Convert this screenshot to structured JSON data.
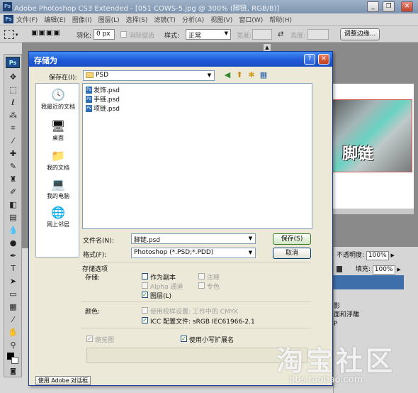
{
  "app": {
    "title": "Adobe Photoshop CS3 Extended - [051 COWS-5.jpg @ 300% (脚链, RGB/8)]",
    "menu": [
      "文件(F)",
      "编辑(E)",
      "图像(I)",
      "图层(L)",
      "选择(S)",
      "滤镜(T)",
      "分析(A)",
      "视图(V)",
      "窗口(W)",
      "帮助(H)"
    ],
    "window_buttons": {
      "minimize": "_",
      "restore": "❐",
      "close": "✕"
    }
  },
  "options": {
    "feather_label": "羽化:",
    "feather_value": "0 px",
    "antialias_label": "消除锯齿",
    "style_label": "样式:",
    "style_value": "正常",
    "width_label": "宽度:",
    "height_label": "高度:",
    "refine_edge_label": "调整边缘..."
  },
  "toolbox": {
    "badge": "Ps"
  },
  "canvas": {
    "caption": "脚链"
  },
  "panels": {
    "opacity_label": "不透明度:",
    "opacity_value": "100%",
    "fill_label": "填充:",
    "fill_value": "100%",
    "layer_item_1": "影",
    "layer_item_2": "面和浮雕",
    "layer_item_3": "P"
  },
  "dialog": {
    "title": "存储为",
    "save_in_label": "保存在(I):",
    "save_in_value": "PSD",
    "places": [
      {
        "label": "我最近的文档",
        "icon": "recent-documents-icon"
      },
      {
        "label": "桌面",
        "icon": "desktop-icon"
      },
      {
        "label": "我的文档",
        "icon": "my-documents-icon"
      },
      {
        "label": "我的电脑",
        "icon": "my-computer-icon"
      },
      {
        "label": "网上邻居",
        "icon": "network-places-icon"
      }
    ],
    "files": [
      "发饰.psd",
      "手链.psd",
      "项链.psd"
    ],
    "filename_label": "文件名(N):",
    "filename_value": "脚链.psd",
    "format_label": "格式(F):",
    "format_value": "Photoshop (*.PSD;*.PDD)",
    "save_button": "保存(S)",
    "cancel_button": "取消",
    "save_options_heading": "存储选项",
    "save_label": "存储:",
    "as_copy": "作为副本",
    "annotations": "注释",
    "alpha_channels": "Alpha 通道",
    "spot_colors": "专色",
    "layers": "图层(L)",
    "color_label": "颜色:",
    "use_proof": "使用校样设置: 工作中的 CMYK",
    "icc_profile": "ICC 配置文件: sRGB IEC61966-2.1",
    "thumbnail": "缩览图",
    "lower_ext": "使用小写扩展名",
    "adobe_dialog_button": "使用 Adobe 对话框"
  },
  "watermark": {
    "text": "淘宝社区",
    "url": "bbs.taobao.com"
  }
}
